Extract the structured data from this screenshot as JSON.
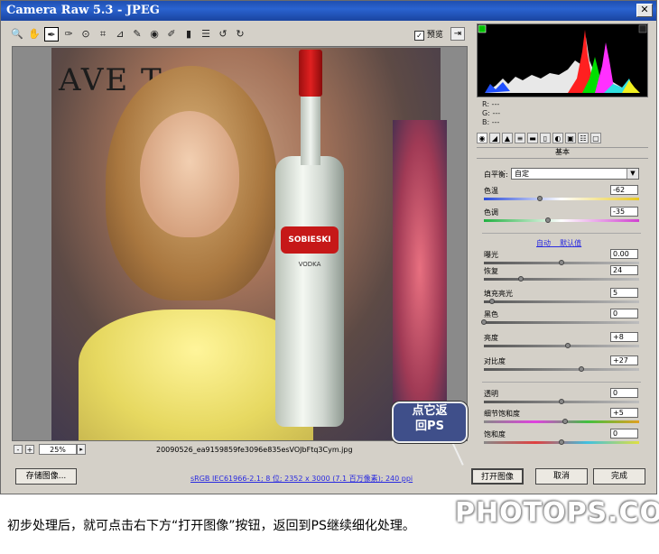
{
  "window": {
    "title": "Camera Raw 5.3  -  JPEG",
    "close_glyph": "✕"
  },
  "toolbar": {
    "tools": [
      {
        "name": "zoom-tool-icon",
        "glyph": "🔍"
      },
      {
        "name": "hand-tool-icon",
        "glyph": "✋"
      },
      {
        "name": "white-balance-tool-icon",
        "glyph": "✒"
      },
      {
        "name": "color-sampler-tool-icon",
        "glyph": "✑"
      },
      {
        "name": "target-adjustment-tool-icon",
        "glyph": "⊙"
      },
      {
        "name": "crop-tool-icon",
        "glyph": "⌗"
      },
      {
        "name": "straighten-tool-icon",
        "glyph": "⊿"
      },
      {
        "name": "spot-removal-tool-icon",
        "glyph": "✎"
      },
      {
        "name": "red-eye-tool-icon",
        "glyph": "◉"
      },
      {
        "name": "adjustment-brush-icon",
        "glyph": "✐"
      },
      {
        "name": "graduated-filter-icon",
        "glyph": "▮"
      },
      {
        "name": "preferences-icon",
        "glyph": "☰"
      },
      {
        "name": "rotate-left-icon",
        "glyph": "↺"
      },
      {
        "name": "rotate-right-icon",
        "glyph": "↻"
      }
    ],
    "preview_label": "预览",
    "preview_checked": "✓",
    "fullscreen_glyph": "⇥"
  },
  "image": {
    "banner_text": "AVE T",
    "bottle_label": "SOBIESKI",
    "bottle_sub": "VODKA"
  },
  "callout": {
    "line1": "点它返",
    "line2": "回PS"
  },
  "zoom": {
    "minus": "-",
    "plus": "+",
    "value": "25%",
    "dropdown": "▸"
  },
  "filename": "20090526_ea9159859fe3096e835esVOJbFtq3Cym.jpg",
  "footer": {
    "save_button": "存储图像...",
    "workflow_link": "sRGB IEC61966-2.1; 8 位; 2352 x 3000 (7.1 百万像素); 240 ppi",
    "open_button": "打开图像",
    "cancel_button": "取消",
    "done_button": "完成"
  },
  "readout": {
    "r": "R:  ---",
    "g": "G:  ---",
    "b": "B:  ---"
  },
  "panel_title": "基本",
  "white_balance": {
    "label": "白平衡:",
    "value": "自定",
    "arrow": "▼"
  },
  "auto_link": "自动",
  "default_link": "默认值",
  "sliders": [
    {
      "key": "temperature",
      "label": "色温",
      "value": "-62",
      "pos": 0.36
    },
    {
      "key": "tint",
      "label": "色调",
      "value": "-35",
      "pos": 0.41
    },
    {
      "key": "exposure",
      "label": "曝光",
      "value": "0.00",
      "pos": 0.5
    },
    {
      "key": "recovery",
      "label": "恢复",
      "value": "24",
      "pos": 0.24
    },
    {
      "key": "fill-light",
      "label": "填充亮光",
      "value": "5",
      "pos": 0.05
    },
    {
      "key": "blacks",
      "label": "黑色",
      "value": "0",
      "pos": 0.0
    },
    {
      "key": "brightness",
      "label": "亮度",
      "value": "+8",
      "pos": 0.54
    },
    {
      "key": "contrast",
      "label": "对比度",
      "value": "+27",
      "pos": 0.63
    },
    {
      "key": "clarity",
      "label": "透明",
      "value": "0",
      "pos": 0.5
    },
    {
      "key": "vibrance",
      "label": "细节饱和度",
      "value": "+5",
      "pos": 0.525
    },
    {
      "key": "saturation",
      "label": "饱和度",
      "value": "0",
      "pos": 0.5
    }
  ],
  "colors": {
    "accent_link": "#2a2ae0",
    "titlebar": "#1f4fb0"
  },
  "caption": "初步处理后，就可点击右下方“打开图像”按钮，返回到PS继续细化处理。",
  "watermark": "PHOTOPS.COM"
}
